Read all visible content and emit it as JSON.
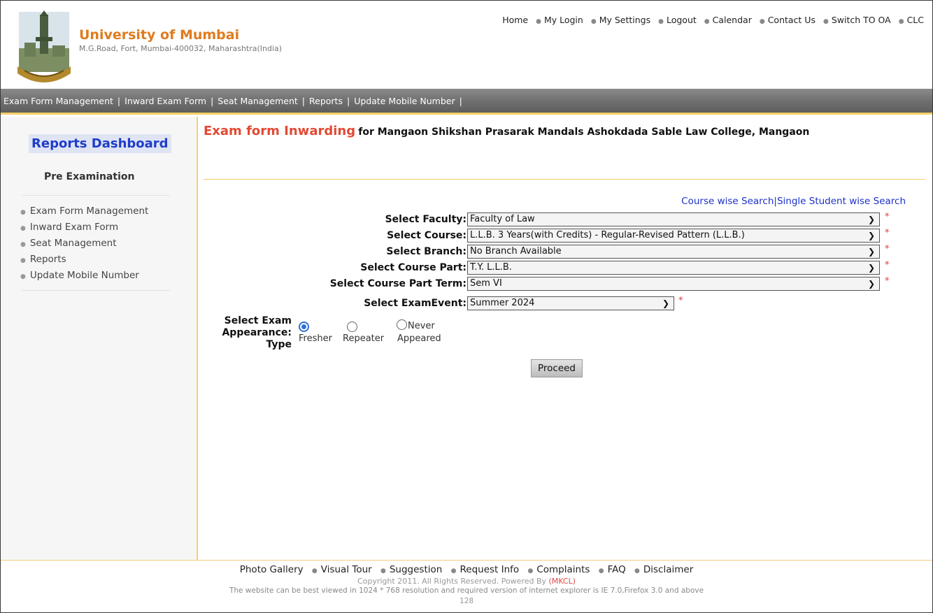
{
  "header": {
    "university_name": "University of Mumbai",
    "address": "M.G.Road, Fort, Mumbai-400032, Maharashtra(India)",
    "top_links": [
      "Home",
      "My Login",
      "My Settings",
      "Logout",
      "Calendar",
      "Contact Us",
      "Switch TO OA",
      "CLC"
    ]
  },
  "navbar": {
    "items": [
      "Exam Form Management",
      "Inward Exam Form",
      "Seat Management",
      "Reports",
      "Update Mobile Number"
    ]
  },
  "sidebar": {
    "title": "Reports Dashboard",
    "section": "Pre Examination",
    "items": [
      "Exam Form Management",
      "Inward Exam Form",
      "Seat Management",
      "Reports",
      "Update Mobile Number"
    ]
  },
  "main": {
    "title": "Exam form Inwarding",
    "subtitle": "for Mangaon Shikshan Prasarak Mandals Ashokdada Sable Law College, Mangaon",
    "search_links": {
      "course": "Course wise Search",
      "separator": "|",
      "single": "Single Student wise Search"
    },
    "fields": {
      "faculty": {
        "label": "Select Faculty:",
        "value": "Faculty of Law"
      },
      "course": {
        "label": "Select Course:",
        "value": "L.L.B. 3 Years(with Credits) - Regular-Revised Pattern (L.L.B.)"
      },
      "branch": {
        "label": "Select Branch:",
        "value": "No Branch Available"
      },
      "course_part": {
        "label": "Select Course Part:",
        "value": "T.Y. L.L.B."
      },
      "course_part_term": {
        "label": "Select Course Part Term:",
        "value": "Sem VI"
      },
      "exam_event": {
        "label": "Select ExamEvent:",
        "value": "Summer 2024"
      }
    },
    "required_mark": "*",
    "appearance": {
      "label_line1": "Select Exam",
      "label_line2": "Appearance:",
      "label_line3": "Type",
      "options": {
        "fresher": "Fresher",
        "repeater": "Repeater",
        "never_line1": "Never",
        "never_line2": "Appeared"
      },
      "selected": "Fresher"
    },
    "proceed_label": "Proceed"
  },
  "footer": {
    "links": [
      "Photo Gallery",
      "Visual Tour",
      "Suggestion",
      "Request Info",
      "Complaints",
      "FAQ",
      "Disclaimer"
    ],
    "copyright": "Copyright 2011. All Rights Reserved. Powered By",
    "powered_by": "(MKCL)",
    "best_view": "The website can be best viewed in 1024 * 768 resolution and required version of internet explorer is IE 7.0,Firefox 3.0 and above",
    "counter": "128"
  },
  "colors": {
    "title_accent": "#e24a33",
    "university_name": "#e07b1f",
    "link_blue": "#1c31c9",
    "required": "#e23c3c",
    "nav_border": "#f2cf63"
  },
  "icons": [
    "university-seal-logo",
    "chevron-down-icon",
    "bullet-dot-icon"
  ]
}
